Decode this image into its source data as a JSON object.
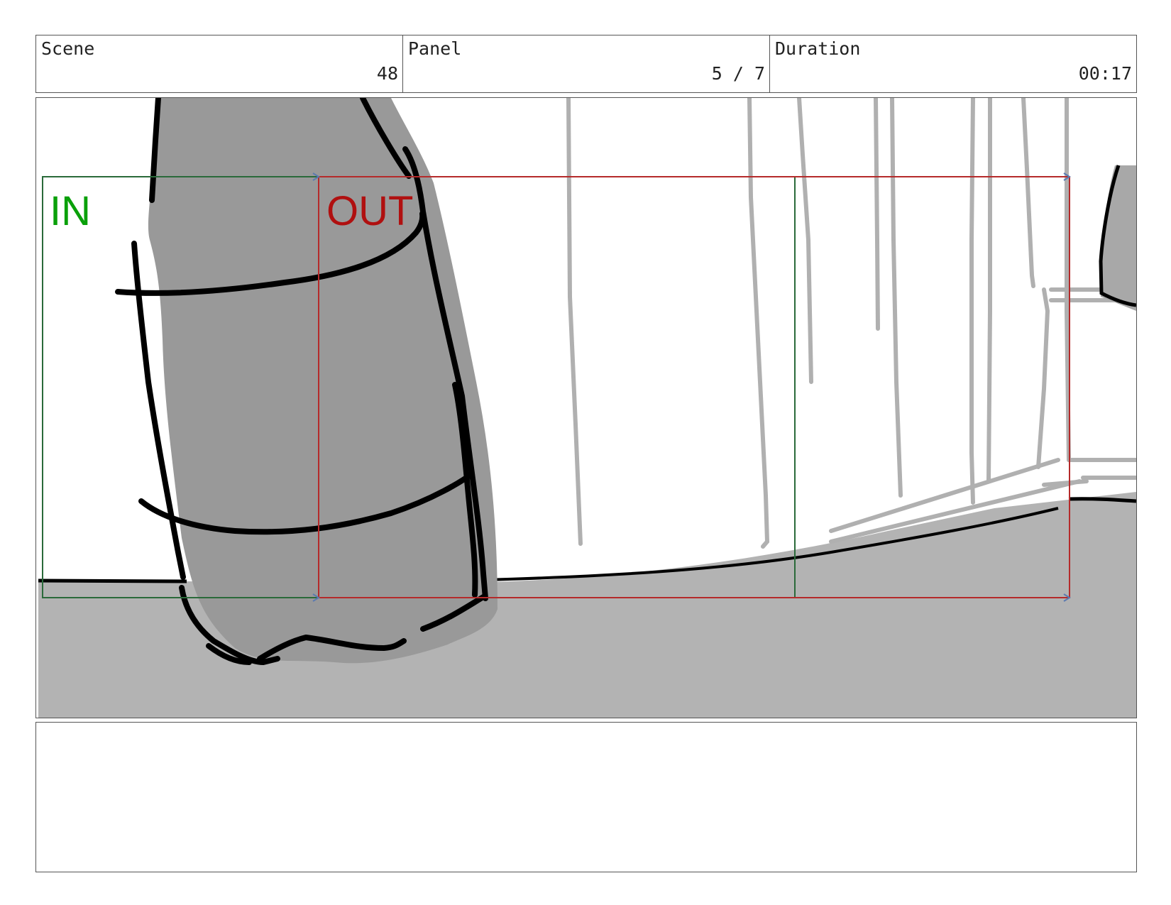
{
  "header": {
    "scene": {
      "label": "Scene",
      "value": "48"
    },
    "panel": {
      "label": "Panel",
      "value": "5 / 7"
    },
    "duration": {
      "label": "Duration",
      "value": "00:17"
    }
  },
  "camera": {
    "in_label": "IN",
    "out_label": "OUT",
    "in_color": "#0aa00a",
    "out_color": "#b01010",
    "in_frame_color": "#2a6a3a",
    "out_frame_color": "#b52a2a"
  },
  "notes": {
    "text": ""
  }
}
